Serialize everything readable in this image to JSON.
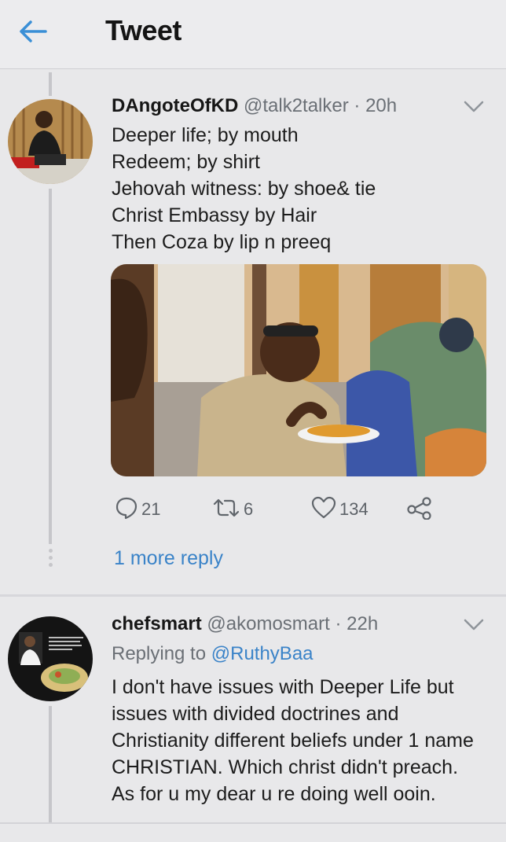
{
  "header": {
    "title": "Tweet"
  },
  "tweet1": {
    "display_name": "DAngoteOfKD",
    "handle": "@talk2talker",
    "separator": "·",
    "time": "20h",
    "lines": [
      "Deeper life; by mouth",
      "Redeem; by shirt",
      "Jehovah witness: by shoe& tie",
      "Christ Embassy by Hair",
      "Then Coza by lip n preeq"
    ],
    "reply_count": "21",
    "retweet_count": "6",
    "like_count": "134",
    "more_reply_label": "1 more reply"
  },
  "tweet2": {
    "display_name": "chefsmart",
    "handle": "@akomosmart",
    "separator": "·",
    "time": "22h",
    "replying_label": "Replying to",
    "replying_handle": "@RuthyBaa",
    "lines": [
      "I don't have issues with Deeper Life but",
      "issues with divided doctrines and",
      "Christianity different beliefs under 1 name",
      "CHRISTIAN. Which christ didn't preach.",
      "As for u my dear u re doing well ooin."
    ]
  },
  "colors": {
    "accent": "#3a83c8",
    "background": "#e8e8ea",
    "muted_text": "#6a6f75"
  },
  "icons": [
    "back-arrow-icon",
    "chevron-down-icon",
    "reply-icon",
    "retweet-icon",
    "like-icon",
    "share-icon"
  ]
}
